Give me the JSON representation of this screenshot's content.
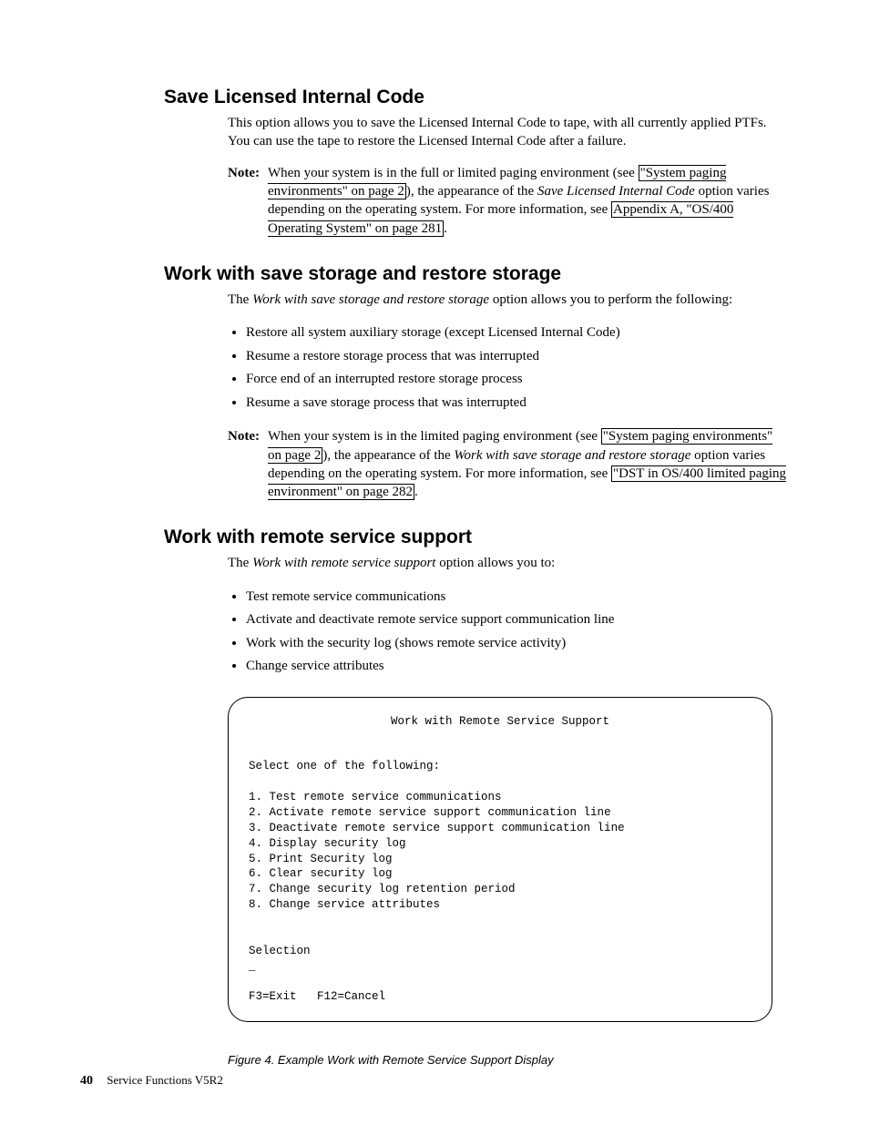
{
  "sections": {
    "s1": {
      "heading": "Save Licensed Internal Code",
      "para1": "This option allows you to save the Licensed Internal Code to tape, with all currently applied PTFs. You can use the tape to restore the Licensed Internal Code after a failure.",
      "note_label": "Note:",
      "note_pre": "When your system is in the full or limited paging environment (see ",
      "note_link1": "\"System paging environments\" on page 2",
      "note_mid1": "), the appearance of the ",
      "note_italic": "Save Licensed Internal Code",
      "note_mid2": " option varies depending on the operating system. For more information, see ",
      "note_link2": "Appendix A, \"OS/400 Operating System\" on page 281",
      "note_post": "."
    },
    "s2": {
      "heading": "Work with save storage and restore storage",
      "para1_pre": "The ",
      "para1_italic": "Work with save storage and restore storage",
      "para1_post": " option allows you to perform the following:",
      "bullets": [
        "Restore all system auxiliary storage (except Licensed Internal Code)",
        "Resume a restore storage process that was interrupted",
        "Force end of an interrupted restore storage process",
        "Resume a save storage process that was interrupted"
      ],
      "note_label": "Note:",
      "note_pre": "When your system is in the limited paging environment (see ",
      "note_link1": "\"System paging environments\" on page 2",
      "note_mid1": "), the appearance of the ",
      "note_italic": "Work with save storage and restore storage",
      "note_mid2": " option varies depending on the operating system. For more information, see ",
      "note_link2": "\"DST in OS/400 limited paging environment\" on page 282",
      "note_post": "."
    },
    "s3": {
      "heading": "Work with remote service support",
      "para1_pre": "The ",
      "para1_italic": "Work with remote service support",
      "para1_post": " option allows you to:",
      "bullets": [
        "Test remote service communications",
        "Activate and deactivate remote service support communication line",
        "Work with the security log (shows remote service activity)",
        "Change service attributes"
      ]
    }
  },
  "terminal": {
    "title": "Work with Remote Service Support",
    "prompt": "Select one of the following:",
    "items": [
      "1. Test remote service communications",
      "2. Activate remote service support communication line",
      "3. Deactivate remote service support communication line",
      "4. Display security log",
      "5. Print Security log",
      "6. Clear security log",
      "7. Change security log retention period",
      "8. Change service attributes"
    ],
    "selection_label": "Selection",
    "selection_marker": "_",
    "fkeys": "F3=Exit   F12=Cancel"
  },
  "figure_caption": "Figure 4. Example Work with Remote Service Support Display",
  "footer": {
    "page": "40",
    "title": "Service Functions V5R2"
  }
}
